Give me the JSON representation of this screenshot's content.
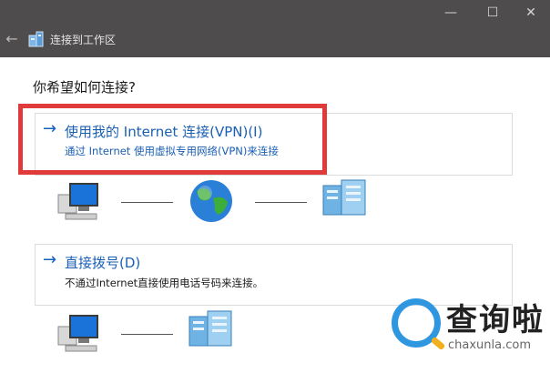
{
  "window": {
    "title": "连接到工作区",
    "controls": {
      "minimize": "—",
      "maximize": "☐",
      "close": "✕"
    },
    "back_icon": "back-arrow-icon",
    "background": "#4e4c4d"
  },
  "main": {
    "question": "你希望如何连接?",
    "options": [
      {
        "arrow": "→",
        "title": "使用我的 Internet 连接(VPN)(I)",
        "description": "通过 Internet 使用虚拟专用网络(VPN)来连接",
        "highlighted": true,
        "diagram_icons": [
          "computer-icon",
          "globe-icon",
          "server-icon"
        ]
      },
      {
        "arrow": "→",
        "title": "直接拨号(D)",
        "description": "不通过Internet直接使用电话号码来连接。",
        "highlighted": false,
        "diagram_icons": [
          "computer-icon",
          "server-icon"
        ]
      }
    ]
  },
  "watermark": {
    "brand": "查询啦",
    "domain": "chaxunla.com"
  },
  "colors": {
    "link": "#1a5fb4",
    "highlight": "#e03a3a",
    "watermark_blue": "#2f96e0",
    "watermark_orange": "#f2b01e"
  }
}
